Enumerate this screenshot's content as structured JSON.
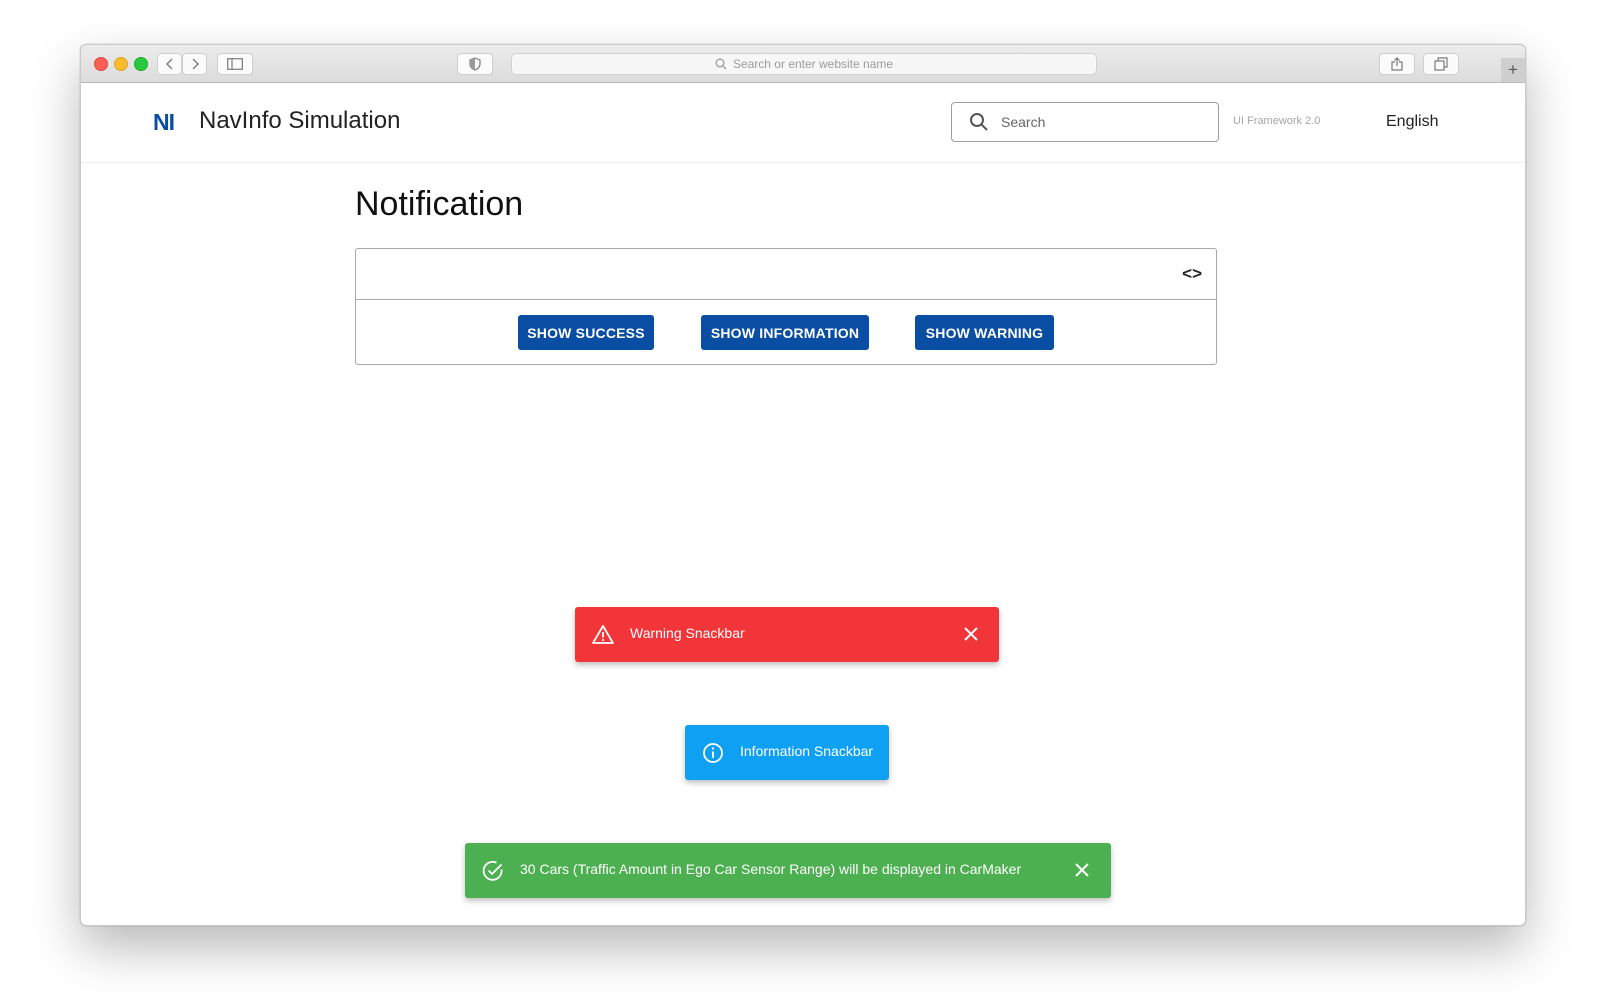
{
  "browser": {
    "url_placeholder": "Search or enter website name"
  },
  "header": {
    "logo_text": "NI",
    "app_title": "NavInfo Simulation",
    "search_placeholder": "Search",
    "framework_label": "UI Framework 2.0",
    "language": "English"
  },
  "page": {
    "title": "Notification",
    "code_toggle_icon": "code-icon"
  },
  "buttons": {
    "success": "SHOW SUCCESS",
    "information": "SHOW INFORMATION",
    "warning": "SHOW WARNING"
  },
  "snackbars": {
    "warning": {
      "text": "Warning Snackbar",
      "color": "#f23538",
      "icon": "warning-triangle-icon"
    },
    "information": {
      "text": "Information Snackbar",
      "color": "#0ea0f2",
      "icon": "info-circle-icon"
    },
    "success": {
      "text": "30 Cars (Traffic Amount in Ego Car Sensor Range) will be displayed in CarMaker",
      "color": "#4caf50",
      "icon": "check-circle-icon"
    }
  },
  "colors": {
    "brand": "#0a4ea3"
  }
}
